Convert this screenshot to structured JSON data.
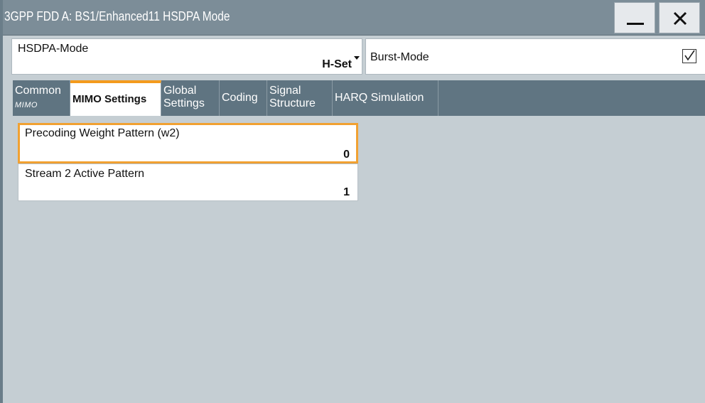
{
  "window": {
    "title": "3GPP FDD A: BS1/Enhanced11 HSDPA Mode",
    "minimize_icon": "minimize-icon",
    "close_icon": "close-icon"
  },
  "params": {
    "hsdpa_mode": {
      "label": "HSDPA-Mode",
      "value": "H-Set"
    },
    "burst_mode": {
      "label": "Burst-Mode",
      "checked": true
    }
  },
  "tabs": [
    {
      "label": "Common",
      "sub": "MIMO"
    },
    {
      "label": "MIMO Settings",
      "active": true
    },
    {
      "line1": "Global",
      "line2": "Settings"
    },
    {
      "label": "Coding"
    },
    {
      "line1": "Signal",
      "line2": "Structure"
    },
    {
      "label": "HARQ Simulation"
    }
  ],
  "mimo": {
    "precoding_weight": {
      "label": "Precoding Weight Pattern (w2)",
      "value": "0"
    },
    "stream2_active": {
      "label": "Stream 2 Active Pattern",
      "value": "1"
    }
  },
  "colors": {
    "titlebar": "#7c8d98",
    "tab_bg": "#5f7481",
    "active_accent": "#f39a1d",
    "panel_bg": "#c5ced3"
  }
}
